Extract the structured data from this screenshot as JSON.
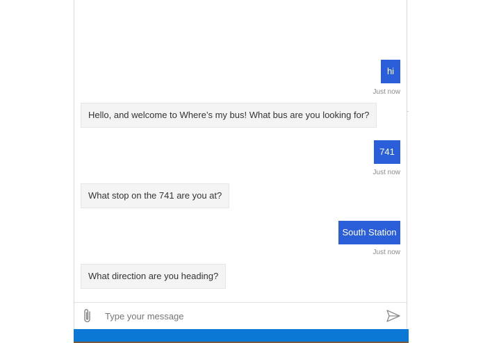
{
  "messages": [
    {
      "from": "user",
      "text": "hi",
      "timestamp": "Just now"
    },
    {
      "from": "bot",
      "text": "Hello, and welcome to Where’s my bus! What bus are you looking for?"
    },
    {
      "from": "user",
      "text": "741",
      "timestamp": "Just now"
    },
    {
      "from": "bot",
      "text": "What stop on the 741 are you at?"
    },
    {
      "from": "user",
      "text": "South Station",
      "timestamp": "Just now"
    },
    {
      "from": "bot",
      "text": "What direction are you heading?"
    }
  ],
  "input": {
    "placeholder": "Type your message",
    "value": ""
  },
  "icons": {
    "attach": "paperclip-icon",
    "send": "send-icon"
  },
  "colors": {
    "user_bubble": "#2b5fd9",
    "bot_bubble": "#f4f4f4",
    "footer_bar": "#0a78d4"
  }
}
